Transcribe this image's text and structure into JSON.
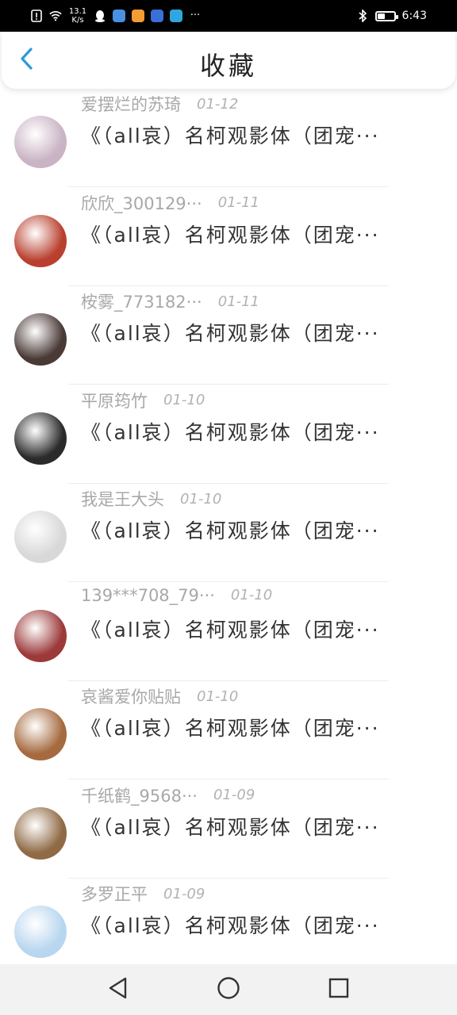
{
  "status_bar": {
    "speed_value": "13.1",
    "speed_unit": "K/s",
    "time": "6:43",
    "battery_level": 0.45,
    "icons": [
      "sim-alert-icon",
      "wifi-icon",
      "qq-icon",
      "app-icon-blue",
      "app-icon-orange",
      "app-icon-bulb",
      "app-icon-search",
      "more-dots-icon",
      "bluetooth-icon",
      "battery-icon"
    ],
    "more": "···"
  },
  "header": {
    "title": "收藏",
    "back_icon": "chevron-left-icon",
    "accent_color": "#2a9bd8"
  },
  "items": [
    {
      "author": "爱摆烂的苏琦",
      "date": "01-12",
      "title": "《（all哀）名柯观影体（团宠···",
      "avatar_color": "#c9b3c4"
    },
    {
      "author": "欣欣_300129···",
      "date": "01-11",
      "title": "《（all哀）名柯观影体（团宠···",
      "avatar_color": "#b9402f"
    },
    {
      "author": "桉雾_773182···",
      "date": "01-11",
      "title": "《（all哀）名柯观影体（团宠···",
      "avatar_color": "#4a3a36"
    },
    {
      "author": "平原筠竹",
      "date": "01-10",
      "title": "《（all哀）名柯观影体（团宠···",
      "avatar_color": "#2b2b2b"
    },
    {
      "author": "我是王大头",
      "date": "01-10",
      "title": "《（all哀）名柯观影体（团宠···",
      "avatar_color": "#d8d8d8"
    },
    {
      "author": "139***708_79···",
      "date": "01-10",
      "title": "《（all哀）名柯观影体（团宠···",
      "avatar_color": "#9c3a3a"
    },
    {
      "author": "哀酱爱你贴贴",
      "date": "01-10",
      "title": "《（all哀）名柯观影体（团宠···",
      "avatar_color": "#a56a3f"
    },
    {
      "author": "千纸鹤_9568···",
      "date": "01-09",
      "title": "《（all哀）名柯观影体（团宠···",
      "avatar_color": "#8f6a45"
    },
    {
      "author": "多罗正平",
      "date": "01-09",
      "title": "《（all哀）名柯观影体（团宠···",
      "avatar_color": "#b8d6ef"
    }
  ],
  "nav_bar": {
    "icons": [
      "back-triangle-icon",
      "home-circle-icon",
      "recents-square-icon"
    ]
  }
}
